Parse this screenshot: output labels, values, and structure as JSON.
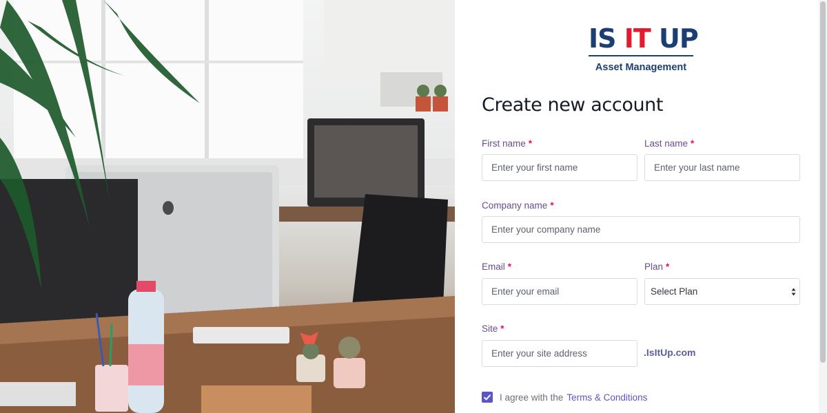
{
  "brand": {
    "logo_part1": "IS",
    "logo_part2": "IT",
    "logo_part3": "UP",
    "tagline": "Asset Management",
    "colors": {
      "primary": "#1b3f74",
      "accent": "#e21b2e",
      "action": "#5a55c9",
      "required": "#e5115c"
    }
  },
  "form": {
    "title": "Create new account",
    "required_marker": "*",
    "first_name": {
      "label": "First name",
      "placeholder": "Enter your first name",
      "value": ""
    },
    "last_name": {
      "label": "Last name",
      "placeholder": "Enter your last name",
      "value": ""
    },
    "company_name": {
      "label": "Company name",
      "placeholder": "Enter your company name",
      "value": ""
    },
    "email": {
      "label": "Email",
      "placeholder": "Enter your email",
      "value": ""
    },
    "plan": {
      "label": "Plan",
      "selected": "Select Plan"
    },
    "site": {
      "label": "Site",
      "placeholder": "Enter your site address",
      "suffix": ".IsItUp.com",
      "value": ""
    },
    "agree": {
      "checked": true,
      "text": "I agree with the",
      "link": "Terms & Conditions"
    }
  }
}
